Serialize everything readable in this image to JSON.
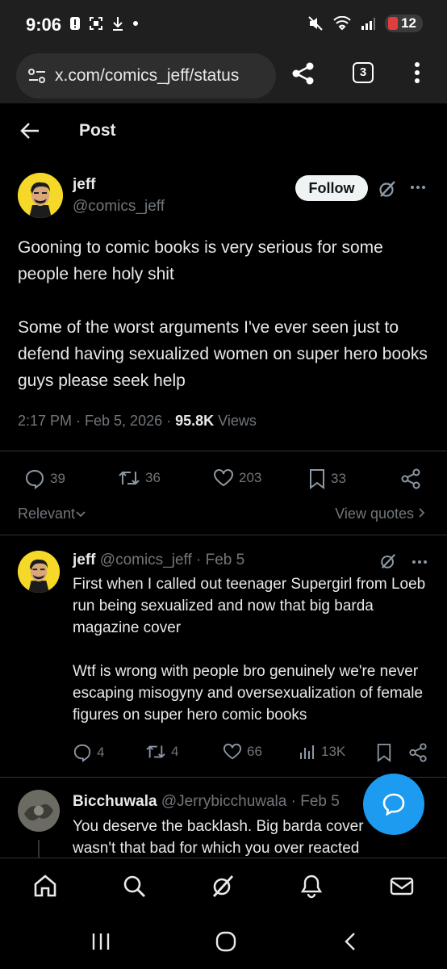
{
  "status_bar": {
    "time": "9:06",
    "battery": "12"
  },
  "browser": {
    "url": "x.com/comics_jeff/status",
    "tab_count": "3"
  },
  "header": {
    "title": "Post"
  },
  "post": {
    "author_name": "jeff",
    "author_handle": "@comics_jeff",
    "follow_label": "Follow",
    "paragraphs": [
      "Gooning to comic books is very serious for some people here holy shit",
      "Some of the worst arguments I've ever seen just to defend having sexualized women on super hero books guys please seek help"
    ],
    "timestamp": "2:17 PM · Feb 5, 2026 · ",
    "views_count": "95.8K",
    "views_label": " Views",
    "replies": "39",
    "reposts": "36",
    "likes": "203",
    "bookmarks": "33"
  },
  "sort": {
    "relevant_label": "Relevant",
    "view_quotes_label": "View quotes"
  },
  "reply1": {
    "name": "jeff",
    "handle_date": " @comics_jeff · Feb 5",
    "paragraphs": [
      "First when I called out teenager Supergirl from Loeb run being sexualized and now that big barda magazine cover",
      "Wtf is wrong with people bro genuinely we're never escaping misogyny and oversexualization of female figures on super hero comic books"
    ],
    "replies": "4",
    "reposts": "4",
    "likes": "66",
    "views": "13K"
  },
  "reply2": {
    "name": "Bicchuwala",
    "handle_date": " @Jerrybicchuwala · Feb 5",
    "text": "You deserve the backlash. Big barda cover wasn't that bad for which you over reacted"
  },
  "colors": {
    "background": "#000000",
    "text": "#e7e9ea",
    "muted": "#71767b",
    "accent": "#1d9bf0",
    "avatar_yellow": "#f6d829"
  },
  "icons": [
    "back-arrow-icon",
    "share-icon",
    "tabs-icon",
    "kebab-menu-icon",
    "grok-icon",
    "more-icon",
    "reply-icon",
    "repost-icon",
    "like-icon",
    "bookmark-icon",
    "share-post-icon",
    "views-icon",
    "chevron-down-icon",
    "chevron-right-icon",
    "compose-chat-icon",
    "home-icon",
    "search-icon",
    "grok-nav-icon",
    "notifications-icon",
    "messages-icon"
  ]
}
